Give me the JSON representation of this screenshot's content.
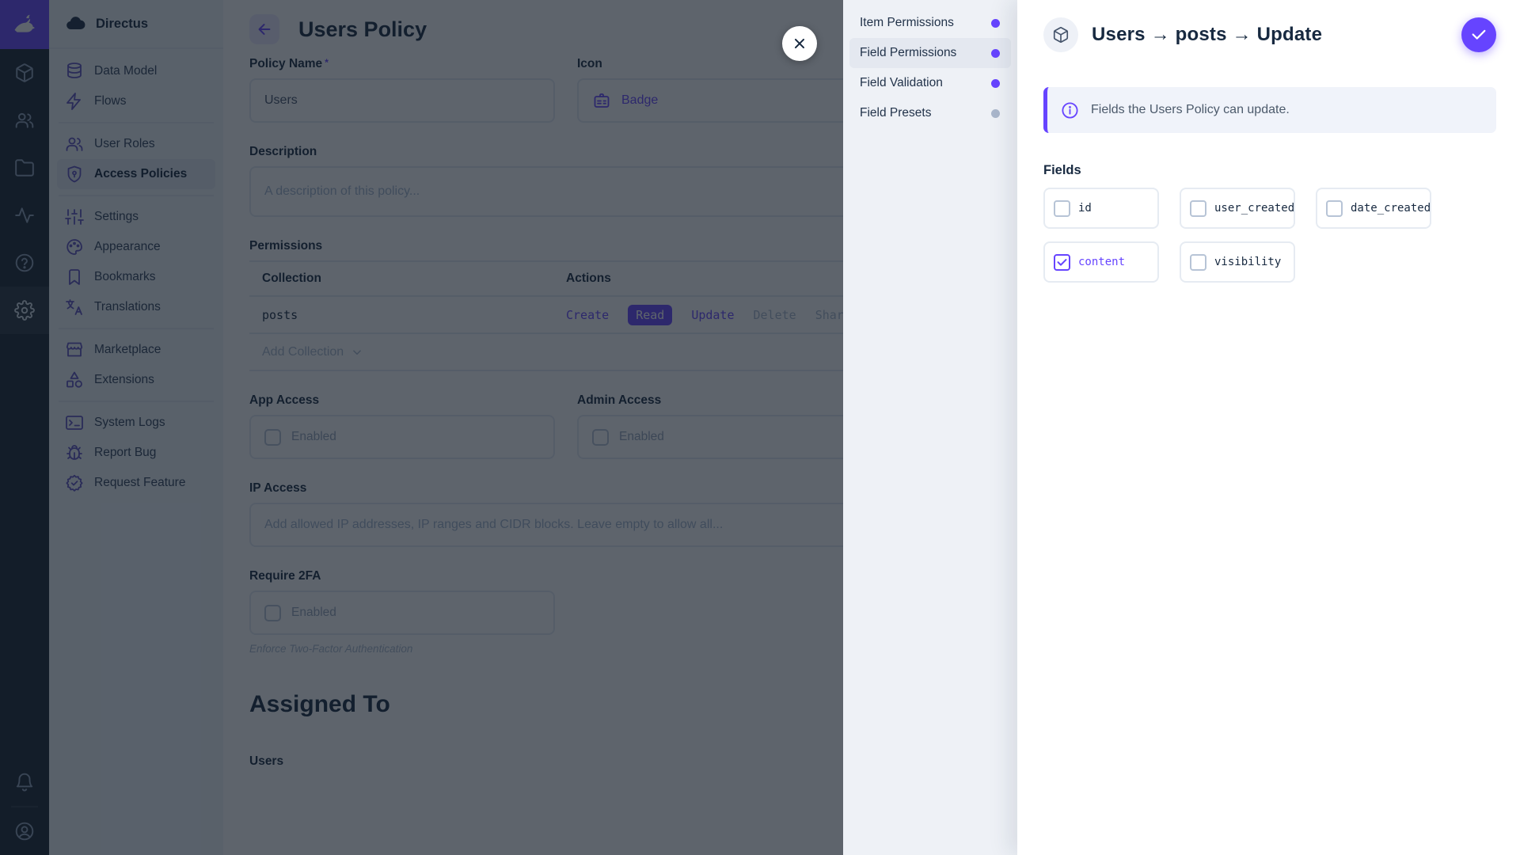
{
  "colors": {
    "accent": "#6644ff",
    "heading": "#172940",
    "muted": "#a2b5cd",
    "module_bar_bg": "#18222f",
    "sidebar_bg": "#f0f4f9",
    "drawer_nav_bg": "#eef1f6"
  },
  "module_bar": {
    "logo_icon": "rabbit-logo",
    "top_icons": [
      "cube",
      "people",
      "folder",
      "activity",
      "help"
    ],
    "active_icon": "settings-gear",
    "bottom_icons": [
      "bell",
      "account-circle"
    ]
  },
  "sidebar": {
    "project_name": "Directus",
    "groups": [
      {
        "items": [
          {
            "icon": "database",
            "label": "Data Model"
          },
          {
            "icon": "bolt",
            "label": "Flows"
          }
        ]
      },
      {
        "items": [
          {
            "icon": "people",
            "label": "User Roles"
          },
          {
            "icon": "shield-lock",
            "label": "Access Policies",
            "active": true
          }
        ]
      },
      {
        "items": [
          {
            "icon": "tune-sliders",
            "label": "Settings"
          },
          {
            "icon": "palette",
            "label": "Appearance"
          },
          {
            "icon": "bookmark",
            "label": "Bookmarks"
          },
          {
            "icon": "translate",
            "label": "Translations"
          }
        ]
      },
      {
        "items": [
          {
            "icon": "storefront",
            "label": "Marketplace"
          },
          {
            "icon": "shapes-category",
            "label": "Extensions"
          }
        ]
      },
      {
        "items": [
          {
            "icon": "terminal",
            "label": "System Logs"
          },
          {
            "icon": "bug",
            "label": "Report Bug"
          },
          {
            "icon": "verified-badge",
            "label": "Request Feature"
          }
        ]
      }
    ]
  },
  "main": {
    "title": "Users Policy",
    "policy_name": {
      "label": "Policy Name",
      "required": "*",
      "value": "Users"
    },
    "icon_field": {
      "label": "Icon",
      "value": "Badge"
    },
    "description": {
      "label": "Description",
      "placeholder": "A description of this policy..."
    },
    "permissions": {
      "label": "Permissions",
      "columns": {
        "collection": "Collection",
        "actions": "Actions"
      },
      "rows": [
        {
          "collection": "posts",
          "actions": [
            {
              "label": "Create",
              "state": "custom"
            },
            {
              "label": "Read",
              "state": "full"
            },
            {
              "label": "Update",
              "state": "custom"
            },
            {
              "label": "Delete",
              "state": "none"
            },
            {
              "label": "Share",
              "state": "none"
            }
          ]
        }
      ],
      "add_label": "Add Collection"
    },
    "app_access": {
      "label": "App Access",
      "checkbox_label": "Enabled",
      "checked": false
    },
    "admin_access": {
      "label": "Admin Access",
      "checkbox_label": "Enabled",
      "checked": false
    },
    "ip_access": {
      "label": "IP Access",
      "placeholder": "Add allowed IP addresses, IP ranges and CIDR blocks. Leave empty to allow all..."
    },
    "require_2fa": {
      "label": "Require 2FA",
      "checkbox_label": "Enabled",
      "checked": false,
      "note": "Enforce Two-Factor Authentication"
    },
    "assigned_to": {
      "label": "Assigned To",
      "field_label": "Users"
    }
  },
  "drawer": {
    "nav": [
      {
        "label": "Item Permissions",
        "dot": "purple"
      },
      {
        "label": "Field Permissions",
        "dot": "purple",
        "active": true
      },
      {
        "label": "Field Validation",
        "dot": "purple"
      },
      {
        "label": "Field Presets",
        "dot": "gray"
      }
    ],
    "title": "Users → posts → Update",
    "info": "Fields the Users Policy can update.",
    "fields_label": "Fields",
    "fields": [
      {
        "name": "id",
        "checked": false
      },
      {
        "name": "user_created",
        "checked": false
      },
      {
        "name": "date_created",
        "checked": false
      },
      {
        "name": "content",
        "checked": true
      },
      {
        "name": "visibility",
        "checked": false
      }
    ]
  }
}
